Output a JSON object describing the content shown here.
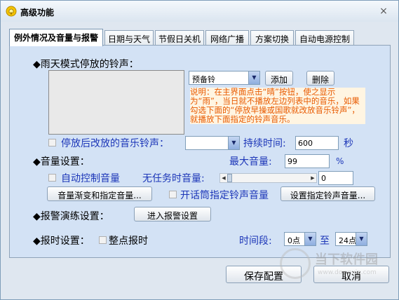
{
  "window": {
    "title": "高级功能",
    "close_glyph": "×"
  },
  "tabs": [
    {
      "label": "例外情况及音量与报警",
      "active": true
    },
    {
      "label": "日期与天气",
      "active": false
    },
    {
      "label": "节假日关机",
      "active": false
    },
    {
      "label": "网络广播",
      "active": false
    },
    {
      "label": "方案切换",
      "active": false
    },
    {
      "label": "自动电源控制",
      "active": false
    }
  ],
  "rain_mode": {
    "heading": "◆雨天模式停放的铃声：",
    "preset_select": "预备铃",
    "add_label": "添加",
    "delete_label": "删除",
    "note": "说明：在主界面点击“晴”按钮，使之显示为“雨”，当日就不播放左边列表中的音乐，如果勾选下面的“停放早操或国歌就改放音乐铃声”，就播放下面指定的铃声音乐。"
  },
  "alt_music": {
    "label": "停放后改放的音乐铃声：",
    "select_value": "",
    "duration_label": "持续时间:",
    "duration_value": "600",
    "unit": "秒"
  },
  "volume": {
    "heading": "◆音量设置：",
    "max_label": "最大音量:",
    "max_value": "99",
    "percent": "%",
    "auto_label": "自动控制音量",
    "idle_label": "无任务时音量:",
    "idle_value": "0",
    "fade_button": "音量渐变和指定音量...",
    "mic_label": "开话筒指定铃声音量",
    "mic_button": "设置指定铃声音量..."
  },
  "alarm": {
    "heading": "◆报警演练设置：",
    "enter_button": "进入报警设置"
  },
  "chime": {
    "heading": "◆报时设置：",
    "hourly_label": "整点报时",
    "period_label": "时间段:",
    "from_value": "0点",
    "to_label": "至",
    "to_value": "24点"
  },
  "footer": {
    "save_label": "保存配置",
    "cancel_label": "取消"
  },
  "watermark": {
    "title": "当下软件园",
    "url": "www.downxia.com"
  },
  "colors": {
    "accent_text": "#1c36b8",
    "note_text": "#e85a00",
    "panel_bg": "#d3e2f5"
  }
}
